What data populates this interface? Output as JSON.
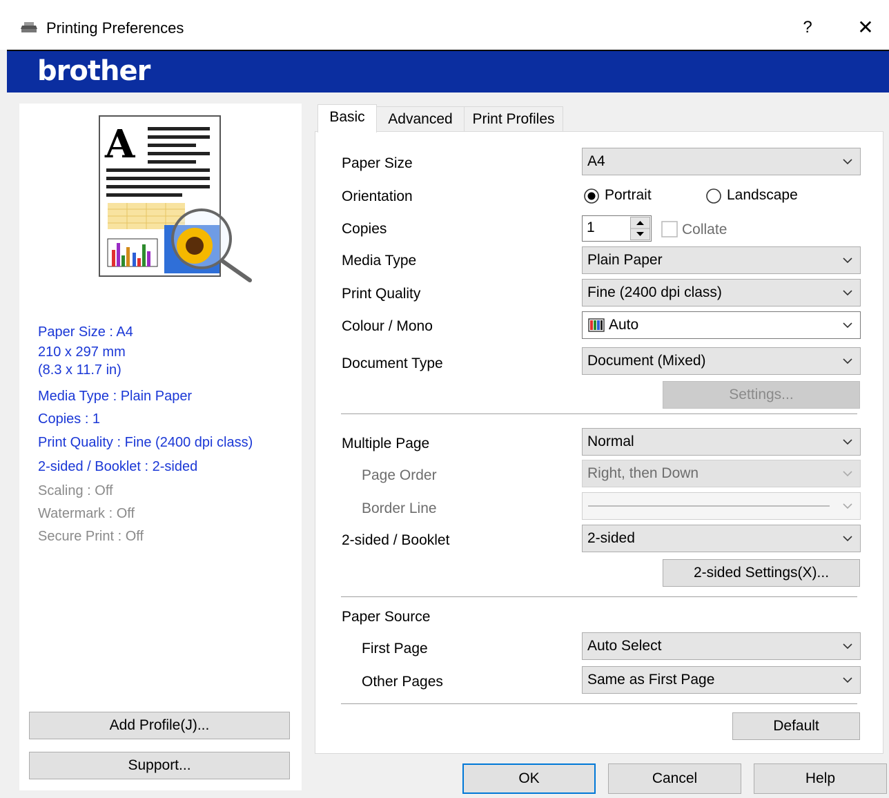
{
  "window": {
    "title": "Printing Preferences",
    "help_label": "?",
    "close_label": "✕",
    "brand": "brother",
    "brand_color": "#0b2ea0"
  },
  "tabs": [
    {
      "label": "Basic",
      "active": true
    },
    {
      "label": "Advanced",
      "active": false
    },
    {
      "label": "Print Profiles",
      "active": false
    }
  ],
  "summary": [
    {
      "text": "Paper Size : A4",
      "enabled": true
    },
    {
      "text": "210 x 297 mm",
      "enabled": true
    },
    {
      "text": "(8.3 x 11.7 in)",
      "enabled": true
    },
    {
      "text": "Media Type : Plain Paper",
      "enabled": true
    },
    {
      "text": "Copies : 1",
      "enabled": true
    },
    {
      "text": "Print Quality : Fine (2400 dpi class)",
      "enabled": true
    },
    {
      "text": "2-sided / Booklet : 2-sided",
      "enabled": true
    },
    {
      "text": "Scaling : Off",
      "enabled": false
    },
    {
      "text": "Watermark : Off",
      "enabled": false
    },
    {
      "text": "Secure Print : Off",
      "enabled": false
    }
  ],
  "left_buttons": {
    "add_profile": "Add Profile(J)...",
    "support": "Support..."
  },
  "basic": {
    "paper_size": {
      "label": "Paper Size",
      "value": "A4"
    },
    "orientation": {
      "label": "Orientation",
      "portrait": "Portrait",
      "landscape": "Landscape",
      "selected": "Portrait"
    },
    "copies": {
      "label": "Copies",
      "value": "1",
      "collate_label": "Collate",
      "collate_checked": false
    },
    "media_type": {
      "label": "Media Type",
      "value": "Plain Paper"
    },
    "print_quality": {
      "label": "Print Quality",
      "value": "Fine (2400 dpi class)"
    },
    "colour_mono": {
      "label": "Colour / Mono",
      "value": "Auto"
    },
    "document_type": {
      "label": "Document Type",
      "value": "Document (Mixed)",
      "settings_label": "Settings..."
    },
    "multiple_page": {
      "label": "Multiple Page",
      "value": "Normal"
    },
    "page_order": {
      "label": "Page Order",
      "value": "Right, then Down"
    },
    "border_line": {
      "label": "Border Line"
    },
    "two_sided": {
      "label": "2-sided / Booklet",
      "value": "2-sided",
      "settings_label": "2-sided Settings(X)..."
    },
    "paper_source": {
      "label": "Paper Source",
      "first_page_label": "First Page",
      "first_page_value": "Auto Select",
      "other_pages_label": "Other Pages",
      "other_pages_value": "Same as First Page"
    },
    "default_label": "Default"
  },
  "footer": {
    "ok": "OK",
    "cancel": "Cancel",
    "help": "Help"
  }
}
